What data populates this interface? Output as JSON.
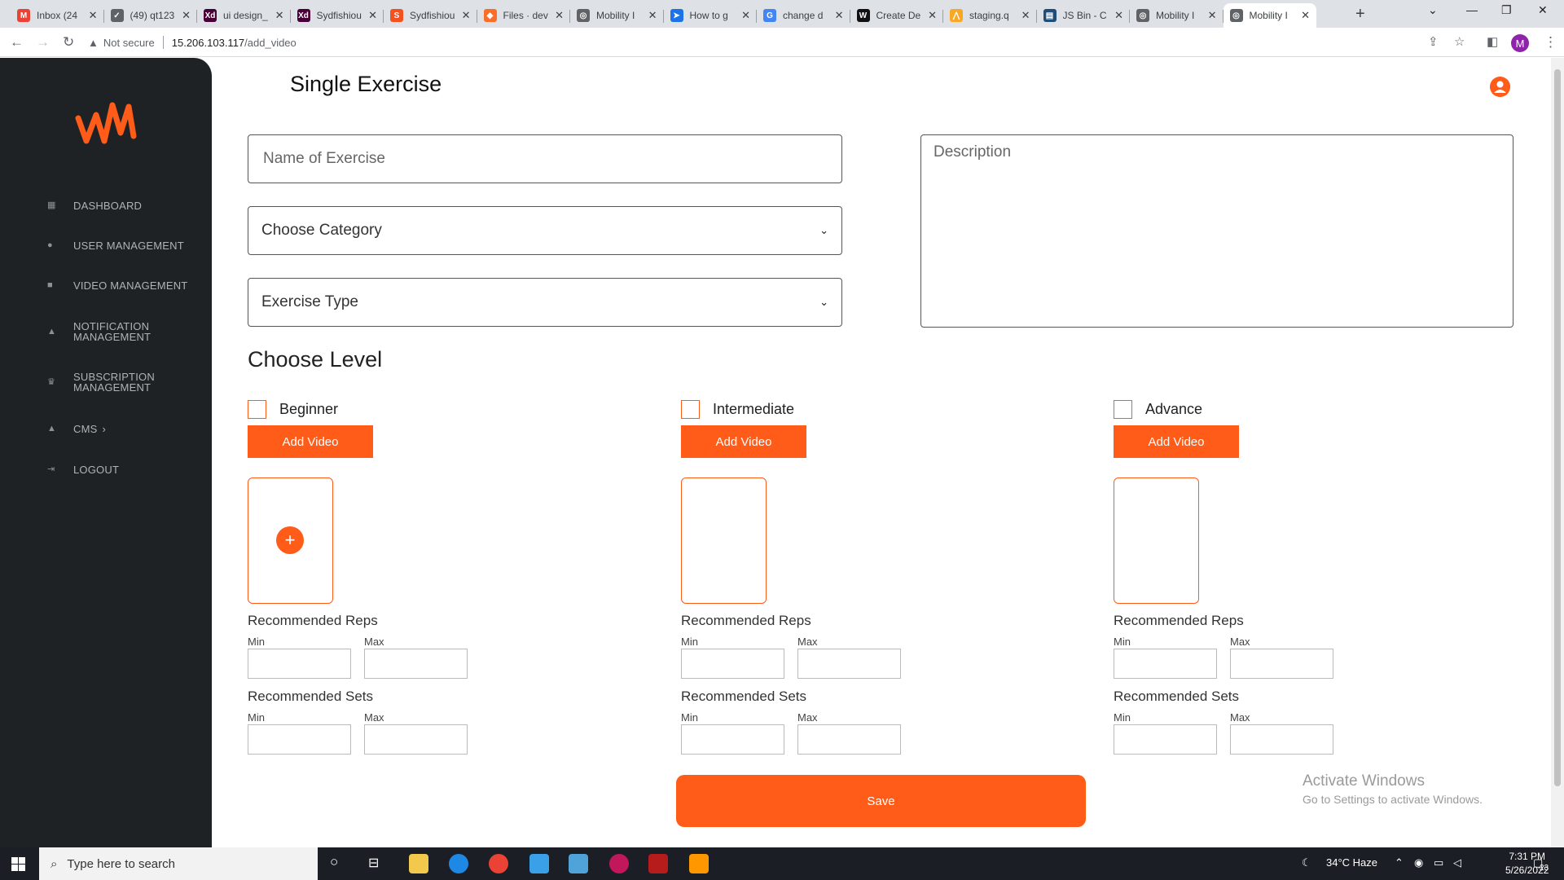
{
  "browser": {
    "tabs": [
      {
        "title": "Inbox (24",
        "color": "#ea4335",
        "glyph": "M"
      },
      {
        "title": "(49) qt123",
        "color": "#5f6368",
        "glyph": "✓"
      },
      {
        "title": "ui design_",
        "color": "#470137",
        "glyph": "Xd"
      },
      {
        "title": "Sydfishiou",
        "color": "#470137",
        "glyph": "Xd"
      },
      {
        "title": "Sydfishiou",
        "color": "#f4511e",
        "glyph": "S"
      },
      {
        "title": "Files · dev",
        "color": "#fc6d26",
        "glyph": "◆"
      },
      {
        "title": "Mobility I",
        "color": "#5f6368",
        "glyph": "◎"
      },
      {
        "title": "How to g",
        "color": "#1a73e8",
        "glyph": "➤"
      },
      {
        "title": "change d",
        "color": "#4285f4",
        "glyph": "G"
      },
      {
        "title": "Create De",
        "color": "#111111",
        "glyph": "W"
      },
      {
        "title": "staging.q",
        "color": "#f9a825",
        "glyph": "⋀"
      },
      {
        "title": "JS Bin - C",
        "color": "#1f4e79",
        "glyph": "▤"
      },
      {
        "title": "Mobility I",
        "color": "#5f6368",
        "glyph": "◎"
      },
      {
        "title": "Mobility I",
        "color": "#5f6368",
        "glyph": "◎"
      }
    ],
    "new_tab": "+",
    "not_secure": "Not secure",
    "url_host": "15.206.103.117",
    "url_path": "/add_video",
    "profile_initial": "M"
  },
  "sidebar": {
    "items": [
      {
        "label": "DASHBOARD",
        "icon": "grid-icon",
        "glyph": "▦"
      },
      {
        "label": "USER MANAGEMENT",
        "icon": "users-icon",
        "glyph": "👥"
      },
      {
        "label": "VIDEO MANAGEMENT",
        "icon": "video-icon",
        "glyph": "■"
      },
      {
        "label": "NOTIFICATION",
        "label2": "MANAGEMENT",
        "icon": "bell-icon",
        "glyph": "🔔"
      },
      {
        "label": "SUBSCRIPTION",
        "label2": "MANAGEMENT",
        "icon": "crown-icon",
        "glyph": "♛"
      },
      {
        "label": "CMS",
        "icon": "bell-icon",
        "glyph": "🔔"
      },
      {
        "label": "LOGOUT",
        "icon": "logout-icon",
        "glyph": "⇥"
      }
    ]
  },
  "main": {
    "title": "Single Exercise",
    "name_placeholder": "Name of Exercise",
    "category_select": "Choose Category",
    "type_select": "Exercise Type",
    "description_placeholder": "Description",
    "level_heading": "Choose Level",
    "levels": [
      {
        "label": "Beginner"
      },
      {
        "label": "Intermediate"
      },
      {
        "label": "Advance"
      }
    ],
    "add_video_label": "Add Video",
    "reps_heading": "Recommended Reps",
    "sets_heading": "Recommended Sets",
    "min_label": "Min",
    "max_label": "Max",
    "save_label": "Save"
  },
  "watermark": {
    "line1": "Activate Windows",
    "line2": "Go to Settings to activate Windows."
  },
  "taskbar": {
    "search_placeholder": "Type here to search",
    "weather": "34°C  Haze",
    "time": "7:31 PM",
    "date": "5/26/2022",
    "notifications": "23"
  },
  "colors": {
    "accent": "#ff5c1a",
    "sidebar_bg": "#1f2225"
  }
}
